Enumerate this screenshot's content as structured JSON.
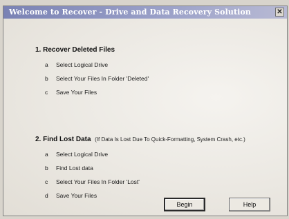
{
  "window": {
    "title": "Welcome to Recover - Drive and Data Recovery Solution",
    "close_label": "✕"
  },
  "section1": {
    "title": "1. Recover Deleted Files",
    "steps": [
      {
        "letter": "a",
        "text": "Select Logical Drive"
      },
      {
        "letter": "b",
        "text": "Select Your Files In Folder 'Deleted'"
      },
      {
        "letter": "c",
        "text": "Save Your Files"
      }
    ]
  },
  "section2": {
    "title": "2.  Find Lost Data",
    "note": "(If Data Is Lost Due To Quick-Formatting, System Crash, etc.)",
    "steps": [
      {
        "letter": "a",
        "text": "Select Logical Drive"
      },
      {
        "letter": "b",
        "text": "Find Lost data"
      },
      {
        "letter": "c",
        "text": "Select Your Files In Folder 'Lost'"
      },
      {
        "letter": "d",
        "text": "Save Your Files"
      }
    ]
  },
  "buttons": {
    "begin": "Begin",
    "help": "Help"
  }
}
